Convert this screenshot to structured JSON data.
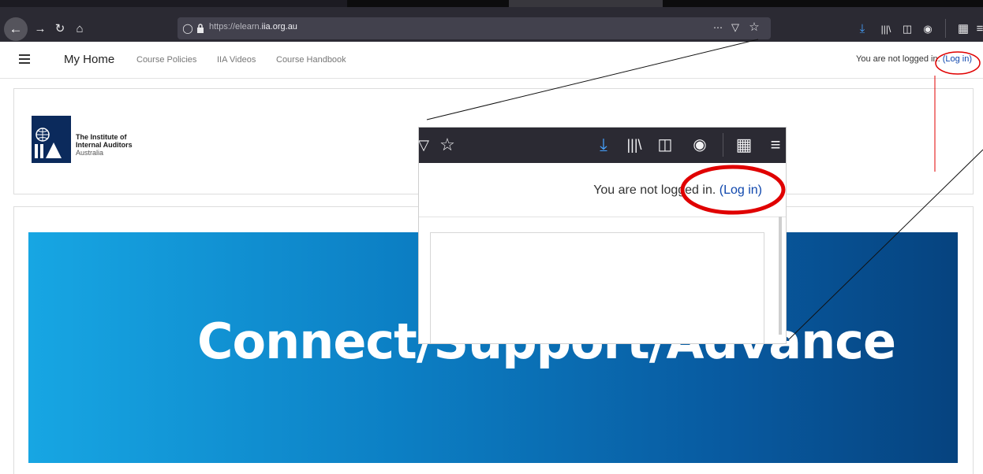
{
  "browser": {
    "url_prefix": "https://",
    "url_subdomain": "elearn.",
    "url_domain": "iia.org.au"
  },
  "nav": {
    "brand": "My Home",
    "links": [
      "Course Policies",
      "IIA Videos",
      "Course Handbook"
    ],
    "login_prefix": "You are not logged in. ",
    "login_link": "(Log in)"
  },
  "logo": {
    "line1": "The Institute of",
    "line2": "Internal Auditors",
    "line3": "Australia"
  },
  "banner": {
    "text": "Connect∕Support∕Advance"
  },
  "zoom": {
    "login_prefix": "You are not logged in. ",
    "login_link": "(Log in)"
  },
  "colors": {
    "toolbar": "#2b2a33",
    "link": "#0f47ad",
    "banner_start": "#17a6e3",
    "banner_end": "#06437f",
    "annotation_red": "#e00000"
  },
  "icons": [
    "back-icon",
    "forward-icon",
    "reload-icon",
    "home-icon",
    "shield-icon",
    "lock-icon",
    "more-icon",
    "pocket-icon",
    "star-icon",
    "download-icon",
    "library-icon",
    "sidebar-icon",
    "account-icon",
    "extension-icon",
    "menu-icon"
  ]
}
